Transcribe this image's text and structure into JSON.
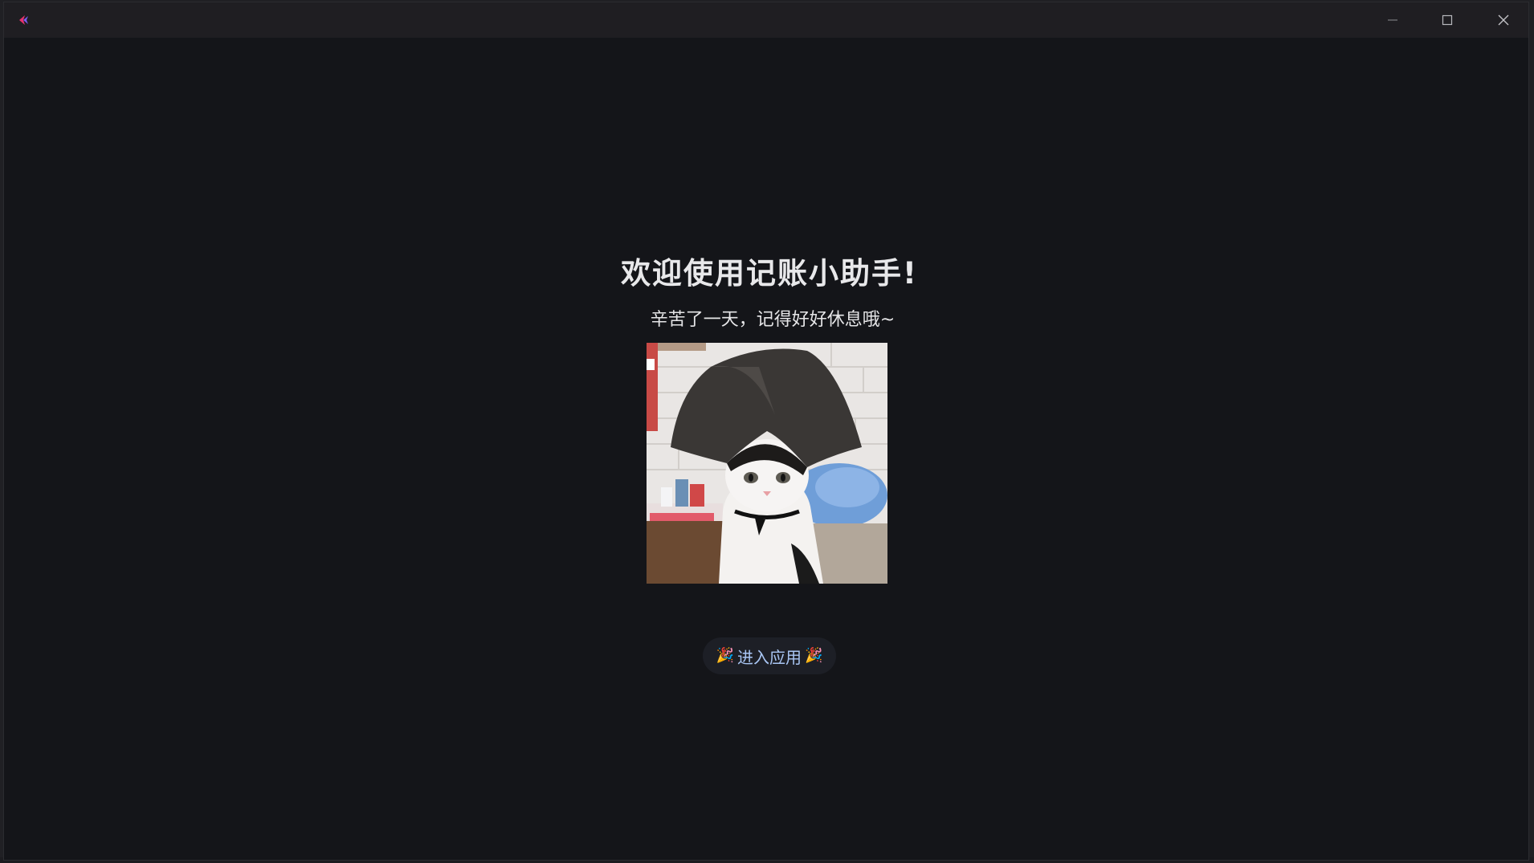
{
  "window": {
    "minimize_label": "Minimize",
    "maximize_label": "Maximize",
    "close_label": "Close"
  },
  "welcome": {
    "title": "欢迎使用记账小助手!",
    "subtitle": "辛苦了一天，记得好好休息哦~",
    "image_alt": "cat wearing a black plastic bag on its head"
  },
  "enter_button": {
    "party_left": "🎉",
    "label": "进入应用",
    "party_right": "🎉"
  },
  "colors": {
    "background": "#141519",
    "titlebar": "#1f1e22",
    "button_text": "#a9c6f4",
    "button_bg": "#1d1f26",
    "accent": "#e8326e"
  },
  "icons": {
    "app": "app-logo-icon",
    "minimize": "minimize-icon",
    "maximize": "maximize-icon",
    "close": "close-icon"
  }
}
